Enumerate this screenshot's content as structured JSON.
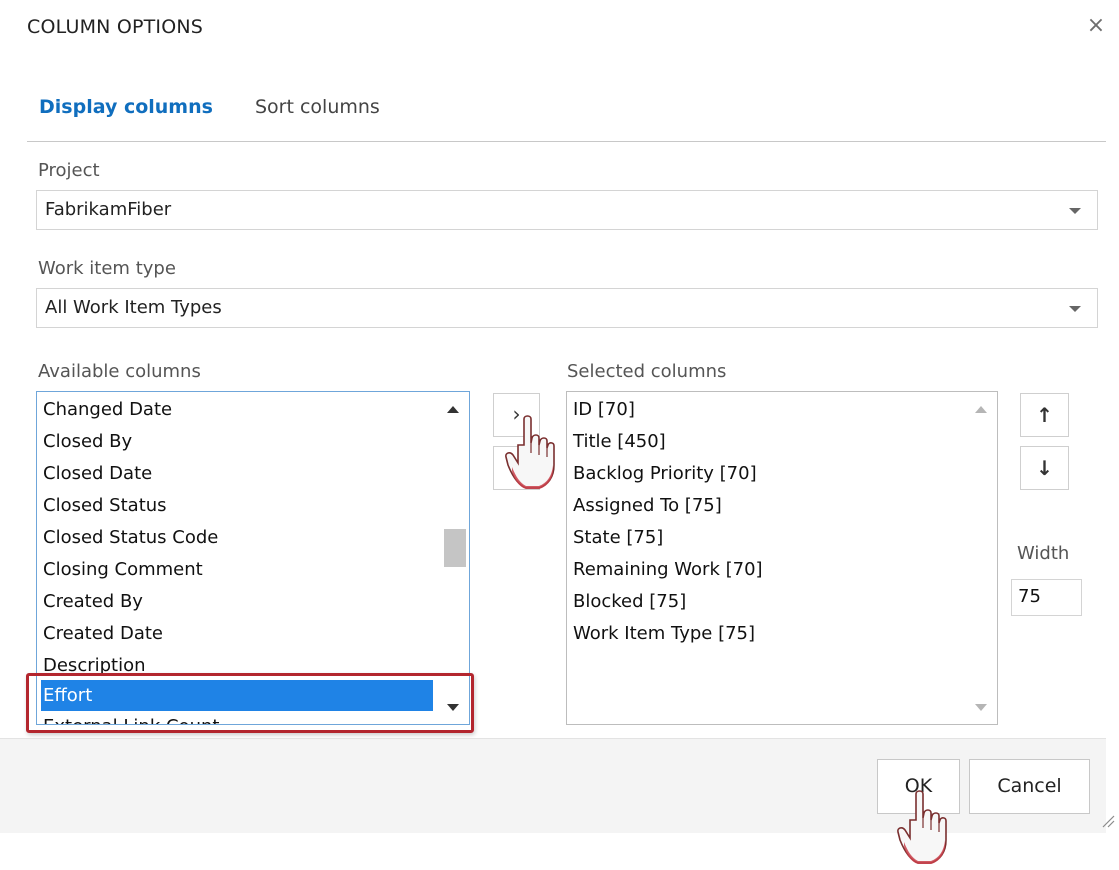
{
  "dialog": {
    "title": "COLUMN OPTIONS",
    "close_glyph": "×"
  },
  "tabs": [
    {
      "label": "Display columns",
      "active": true
    },
    {
      "label": "Sort columns",
      "active": false
    }
  ],
  "project": {
    "label": "Project",
    "value": "FabrikamFiber"
  },
  "work_item_type": {
    "label": "Work item type",
    "value": "All Work Item Types"
  },
  "available_columns": {
    "label": "Available columns",
    "items": [
      "Changed Date",
      "Closed By",
      "Closed Date",
      "Closed Status",
      "Closed Status Code",
      "Closing Comment",
      "Created By",
      "Created Date",
      "Description",
      "Effort",
      "External Link Count"
    ],
    "highlighted": "Effort"
  },
  "selected_columns": {
    "label": "Selected columns",
    "items": [
      "ID [70]",
      "Title [450]",
      "Backlog Priority [70]",
      "Assigned To [75]",
      "State [75]",
      "Remaining Work [70]",
      "Blocked [75]",
      "Work Item Type [75]"
    ]
  },
  "controls": {
    "move_right_glyph": "›",
    "move_up_glyph": "↑",
    "move_down_glyph": "↓",
    "width_label": "Width",
    "width_value": "75"
  },
  "footer": {
    "ok_label": "OK",
    "cancel_label": "Cancel"
  },
  "colors": {
    "accent": "#106ebe",
    "selection": "#1f83e6",
    "highlight_outline": "#b3262e"
  }
}
